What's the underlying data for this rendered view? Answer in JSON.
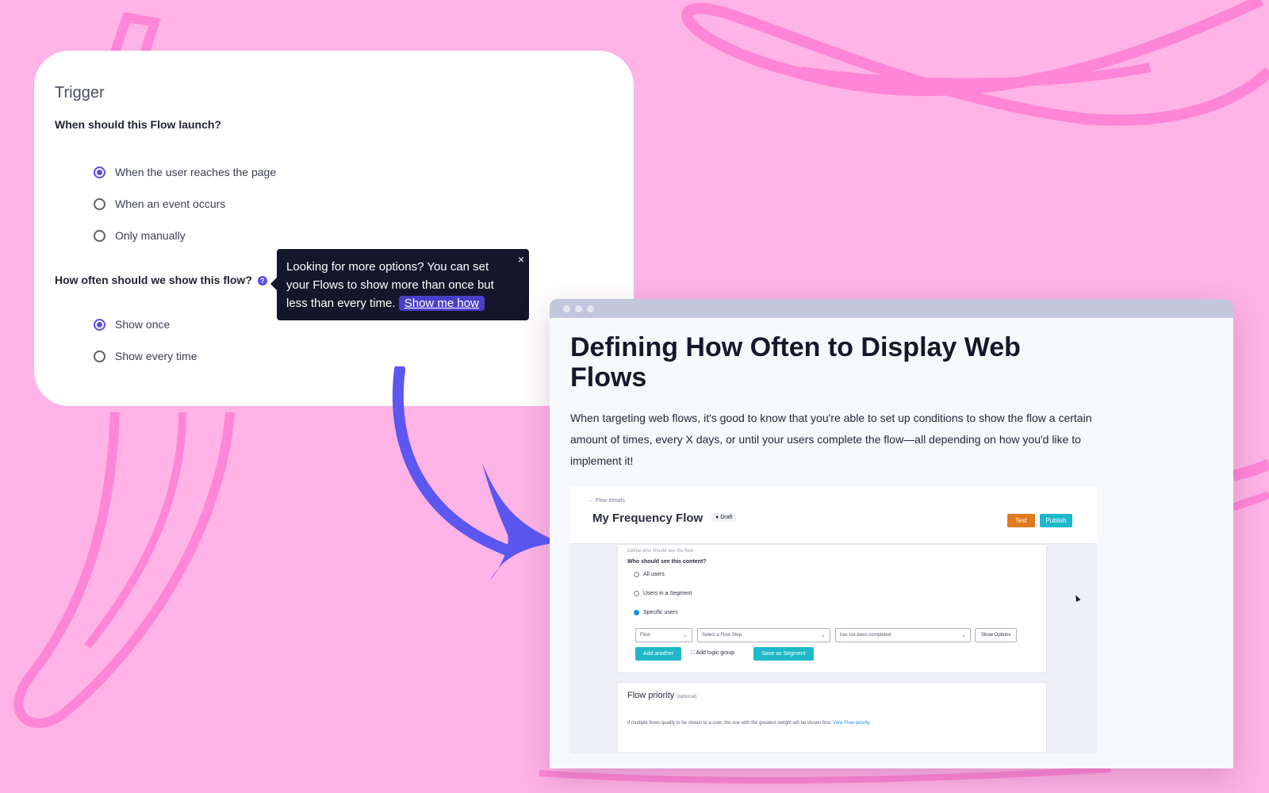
{
  "trigger": {
    "title": "Trigger",
    "launch_question": "When should this Flow launch?",
    "launch_options": [
      "When the user reaches the page",
      "When an event occurs",
      "Only manually"
    ],
    "frequency_question": "How often should we show this flow?",
    "help_icon": "?",
    "frequency_options": [
      "Show once",
      "Show every time"
    ]
  },
  "tooltip": {
    "text": "Looking for more options? You can set your Flows to show more than once but less than every time.",
    "link": "Show me how",
    "close": "×"
  },
  "article": {
    "title": "Defining How Often to Display Web Flows",
    "body": "When targeting web flows, it's good to know that you're able to set up conditions to show the flow a certain amount of times, every X days, or until your users complete the flow—all depending on how you'd like to implement it!"
  },
  "app": {
    "back_link": "Flow details",
    "flow_title": "My Frequency Flow",
    "status_badge": "Draft",
    "test_button": "Test",
    "publish_button": "Publish",
    "section_label": "Define who should see the flow",
    "audience_question": "Who should see this content?",
    "audience_options": [
      "All users",
      "Users in a Segment",
      "Specific users"
    ],
    "selects": [
      "Flow",
      "Select a Flow Step",
      "has not been completed"
    ],
    "show_options": "Show Options",
    "add_another": "Add another",
    "add_logic_group": "Add logic group",
    "save_segment": "Save as Segment",
    "priority_title": "Flow priority",
    "priority_optional": "(optional)",
    "priority_text": "If multiple flows qualify to be shown to a user, the one with the greatest weight will be shown first.",
    "priority_link": "View Flow priority"
  },
  "colors": {
    "background": "#ffb3e6",
    "accent": "#5a4ee6",
    "arrow": "#5b57f0",
    "teal": "#1fb8c8",
    "orange": "#e07a1f"
  },
  "icons": [
    "help-icon",
    "close-icon",
    "arrow-back-icon",
    "chevron-down-icon",
    "logic-group-icon",
    "cursor-icon"
  ]
}
